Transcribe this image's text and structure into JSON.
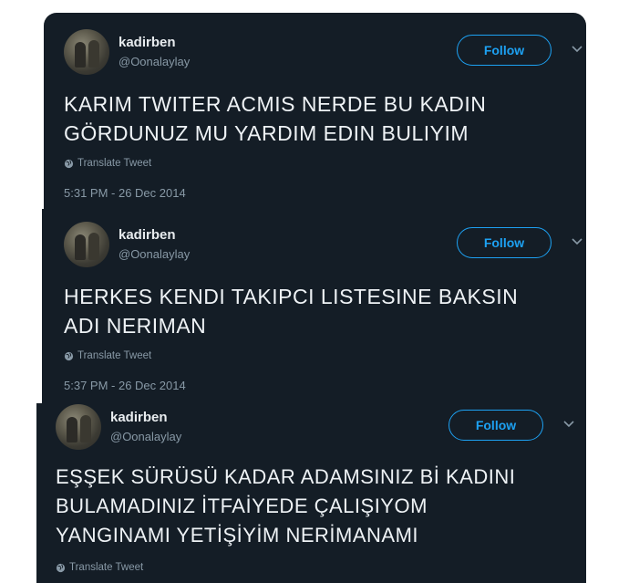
{
  "tweets": [
    {
      "name": "kadirben",
      "handle": "@Oonalaylay",
      "follow_label": "Follow",
      "text": "KARIM TWITER ACMIS NERDE BU KADIN\nGÖRDUNUZ MU YARDIM EDIN BULIYIM",
      "translate_label": "Translate Tweet",
      "timestamp": "5:31 PM - 26 Dec 2014"
    },
    {
      "name": "kadirben",
      "handle": "@Oonalaylay",
      "follow_label": "Follow",
      "text": "HERKES KENDI TAKIPCI LISTESINE BAKSIN\nADI NERIMAN",
      "translate_label": "Translate Tweet",
      "timestamp": "5:37 PM - 26 Dec 2014"
    },
    {
      "name": "kadirben",
      "handle": "@Oonalaylay",
      "follow_label": "Follow",
      "text": "EŞŞEK SÜRÜSÜ KADAR ADAMSINIZ Bİ KADINI\nBULAMADINIZ İTFAİYEDE ÇALIŞIYOM\nYANGINAMI YETİŞİYİM NERİMANAMI",
      "translate_label": "Translate Tweet"
    }
  ],
  "colors": {
    "background": "#141d26",
    "accent": "#1da1f2",
    "secondary_text": "#8899a6",
    "primary_text": "#eef2f5"
  },
  "icons": [
    "avatar",
    "chevron-down-icon",
    "globe-icon"
  ]
}
